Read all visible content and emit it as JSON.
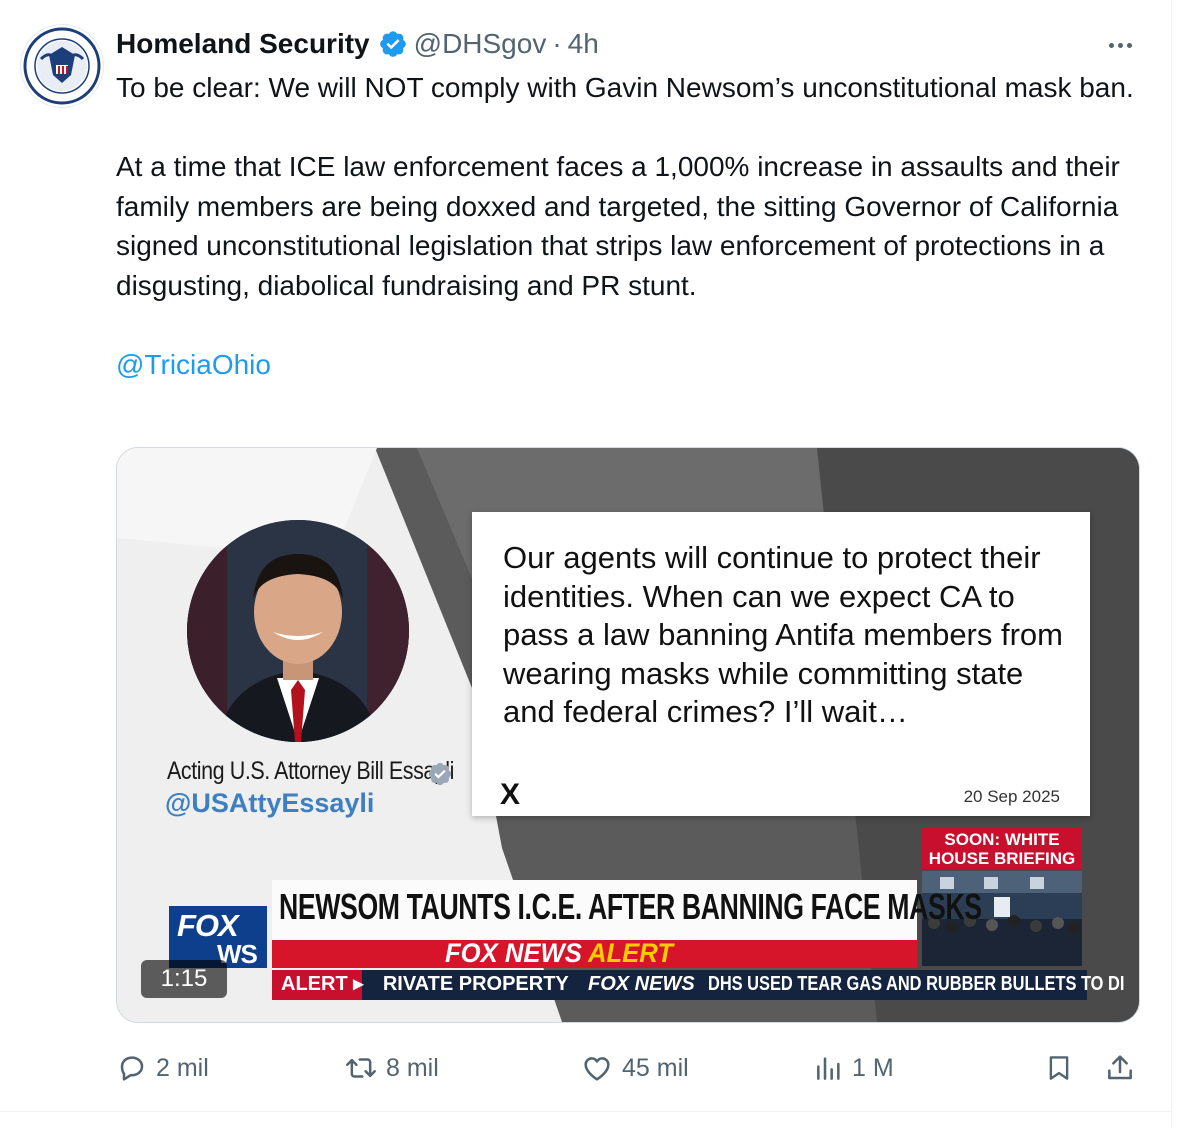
{
  "tweet": {
    "author_name": "Homeland Security",
    "handle": "@DHSgov",
    "separator": "·",
    "time": "4h",
    "paragraphs": [
      "To be clear: We will NOT comply with Gavin Newsom’s unconstitutional mask ban.",
      "At a time that ICE law enforcement faces a 1,000% increase in assaults and their family members are being doxxed and targeted, the sitting Governor of California signed unconstitutional legislation that strips law enforcement of protections in a disgusting, diabolical fundraising and PR stunt."
    ],
    "mention": "@TriciaOhio"
  },
  "video": {
    "duration": "1:15",
    "attorney_title": "Acting U.S. Attorney Bill Essayli",
    "attorney_handle": "@USAttyEssayli",
    "quote_text": "Our agents will continue to protect their identities. When can we expect CA to pass a law banning Antifa members from wearing masks while committing state and federal crimes? I’ll wait…",
    "quote_logo": "X",
    "quote_date": "20 Sep 2025",
    "soon_banner": "SOON: WHITE HOUSE BRIEFING",
    "headline": "NEWSOM TAUNTS I.C.E. AFTER BANNING FACE MASKS",
    "alert_part1": "FOX NEWS",
    "alert_part2": "ALERT",
    "fox_logo_top": "FOX",
    "fox_logo_bottom": "WS",
    "ticker_alert": "ALERT ▸",
    "ticker_left": "RIVATE PROPERTY",
    "ticker_fox": "FOX NEWS",
    "ticker_main": "DHS USED TEAR GAS AND RUBBER BULLETS TO DI"
  },
  "actions": {
    "replies": "2 mil",
    "reposts": "8 mil",
    "likes": "45 mil",
    "views": "1 M"
  },
  "colors": {
    "verified": "#1d9bf0",
    "link": "#1d9bf0",
    "muted": "#536471",
    "fox_red": "#d7152a",
    "fox_blue": "#0d3f8c"
  },
  "icons": [
    "dhs-seal-icon",
    "verified-badge-icon",
    "more-icon",
    "x-logo-icon",
    "reply-icon",
    "repost-icon",
    "like-icon",
    "views-icon",
    "bookmark-icon",
    "share-icon"
  ]
}
